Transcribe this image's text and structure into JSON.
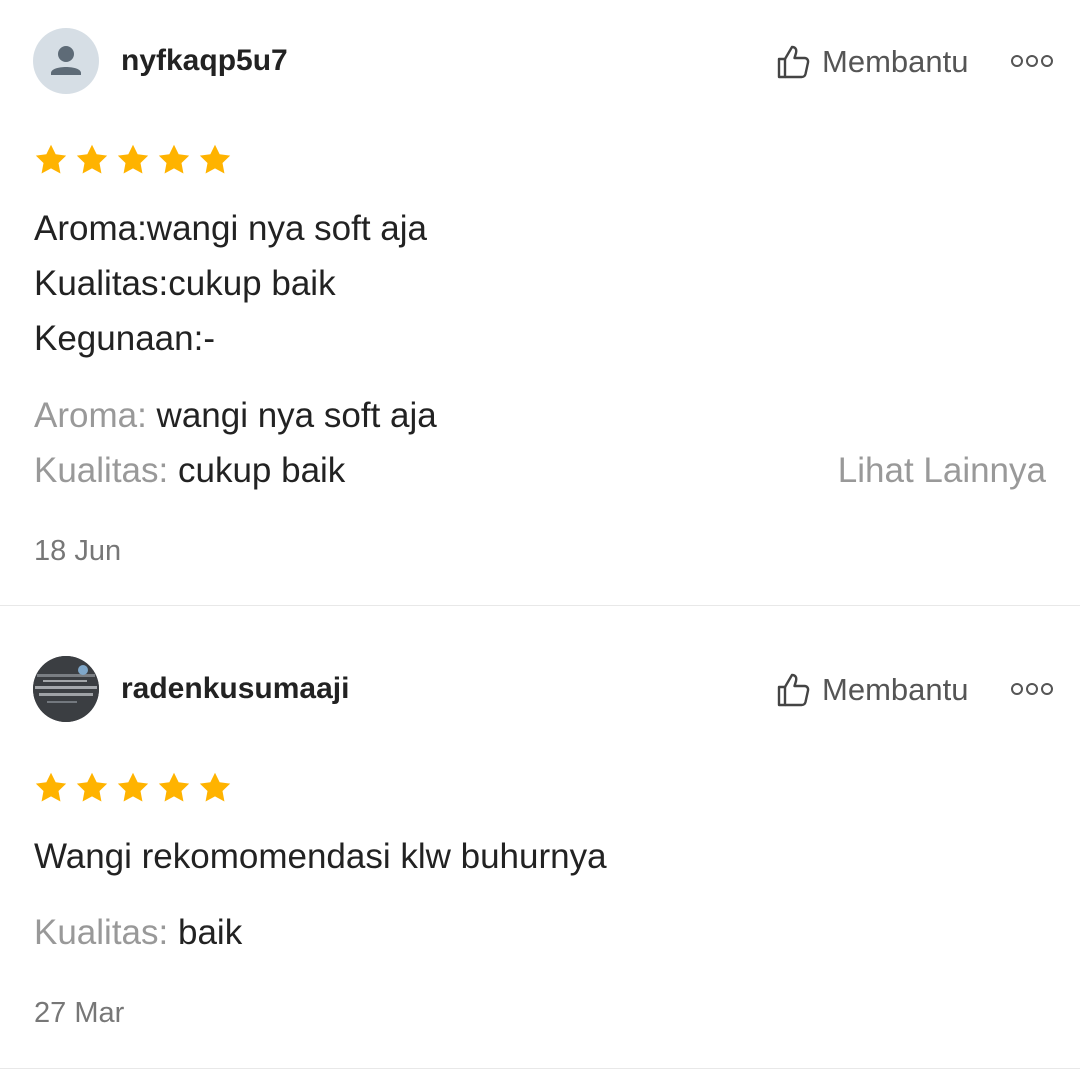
{
  "reviews": [
    {
      "username": "nyfkaqp5u7",
      "avatar": "default-user-avatar",
      "helpful_label": "Membantu",
      "rating": 5,
      "text_lines": [
        "Aroma:wangi nya soft aja",
        "Kualitas:cukup baik",
        "Kegunaan:-"
      ],
      "attributes": [
        {
          "key": "Aroma:",
          "value": "wangi nya soft aja"
        },
        {
          "key": "Kualitas:",
          "value": "cukup baik"
        }
      ],
      "see_more": "Lihat Lainnya",
      "date": "18 Jun"
    },
    {
      "username": "radenkusumaaji",
      "avatar": "photo-avatar",
      "helpful_label": "Membantu",
      "rating": 5,
      "text_lines": [
        "Wangi rekomomendasi klw buhurnya"
      ],
      "attributes": [
        {
          "key": "Kualitas:",
          "value": "baik"
        }
      ],
      "date": "27 Mar"
    }
  ],
  "icons": {
    "helpful": "thumbs-up-icon",
    "more": "more-options-icon",
    "star": "star-icon"
  },
  "colors": {
    "star": "#FFB300",
    "muted_text": "#999999",
    "date_text": "#777777",
    "divider": "#E8E8E8"
  }
}
